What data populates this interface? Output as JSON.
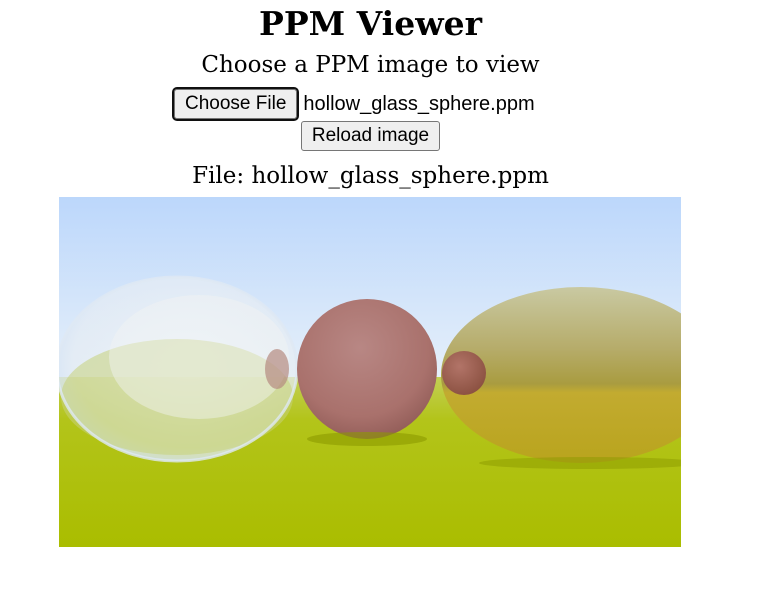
{
  "page": {
    "title": "PPM Viewer",
    "subtitle": "Choose a PPM image to view"
  },
  "file_picker": {
    "button_label": "Choose File",
    "selected_file": "hollow_glass_sphere.ppm"
  },
  "reload": {
    "button_label": "Reload image"
  },
  "file_info": {
    "label": "File: hollow_glass_sphere.ppm"
  },
  "image": {
    "sky_top_color": "#bcd7fb",
    "sky_bottom_color": "#e6f0fa",
    "ground_color": "#b0c400",
    "diffuse_sphere_color": "#b07a76",
    "metal_sphere_color": "#c6b86a"
  }
}
